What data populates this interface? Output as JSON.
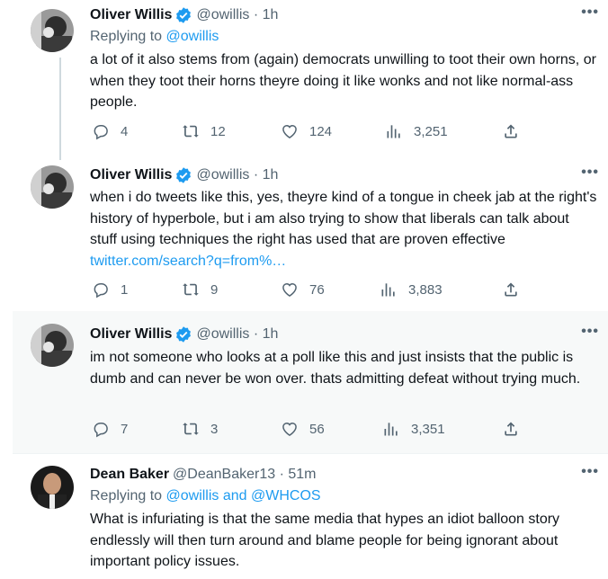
{
  "tweets": [
    {
      "name": "Oliver Willis",
      "handle": "@owillis · 1h",
      "replying_prefix": "Replying to ",
      "replying_to": "@owillis",
      "text": "a lot of it also stems from (again) democrats unwilling to toot their own horns, or when they toot their horns theyre doing it like wonks and not like normal-ass people.",
      "replies": "4",
      "retweets": "12",
      "likes": "124",
      "views": "3,251"
    },
    {
      "name": "Oliver Willis",
      "handle": "@owillis · 1h",
      "text": "when i do tweets like this, yes, theyre kind of a tongue in cheek jab at the right's history of hyperbole, but i am also trying to show that liberals can talk about stuff using techniques the right has used that are proven effective ",
      "link": "twitter.com/search?q=from%…",
      "replies": "1",
      "retweets": "9",
      "likes": "76",
      "views": "3,883"
    },
    {
      "name": "Oliver Willis",
      "handle": "@owillis · 1h",
      "text": "im not someone who looks at a poll like this and just insists that the public is dumb and can never be won over. thats admitting defeat without trying much.",
      "replies": "7",
      "retweets": "3",
      "likes": "56",
      "views": "3,351"
    },
    {
      "name": "Dean Baker",
      "handle": "@DeanBaker13 · 51m",
      "replying_prefix": "Replying to ",
      "replying_to": "@owillis and @WHCOS",
      "text": "What is infuriating is that the same media that hypes an idiot balloon story endlessly will then turn around and blame people for being ignorant about important policy issues."
    }
  ],
  "more_label": "•••",
  "colors": {
    "accent": "#1d9bf0",
    "muted": "#536471",
    "highlight": "#f7f9f9"
  },
  "icons": [
    "verified-badge-icon",
    "reply-icon",
    "retweet-icon",
    "like-icon",
    "views-icon",
    "share-icon",
    "more-icon"
  ]
}
